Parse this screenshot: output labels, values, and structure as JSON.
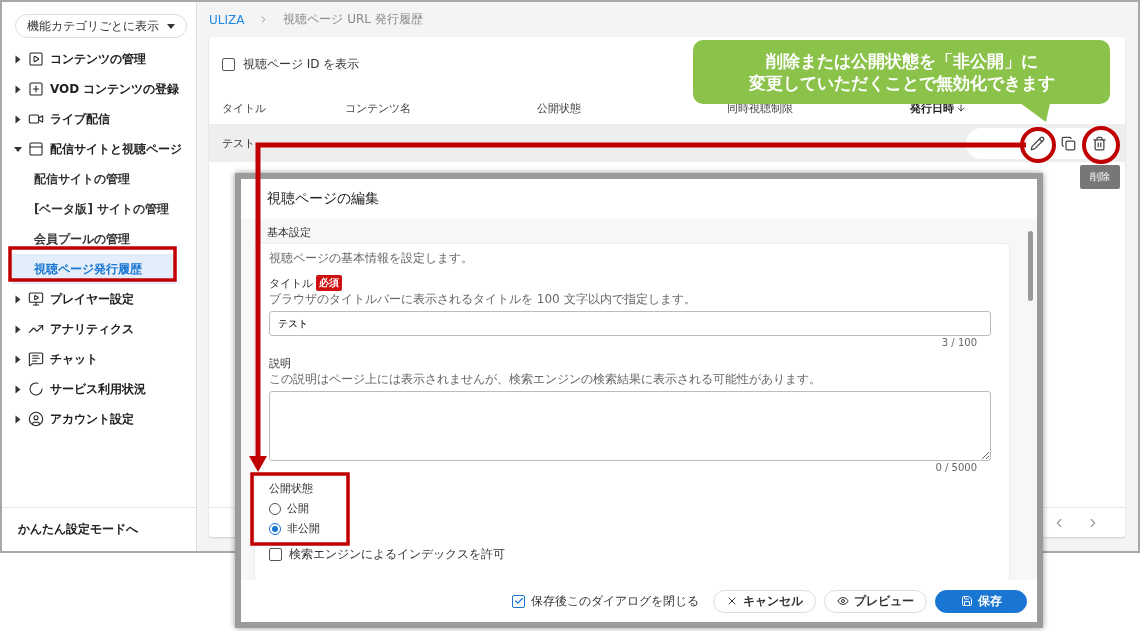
{
  "sidebar": {
    "view_selector": "機能カテゴリごとに表示",
    "items": [
      {
        "label": "コンテンツの管理",
        "expanded": false
      },
      {
        "label": "VOD コンテンツの登録",
        "expanded": false
      },
      {
        "label": "ライブ配信",
        "expanded": false
      },
      {
        "label": "配信サイトと視聴ページ",
        "expanded": true,
        "children": [
          {
            "label": "配信サイトの管理",
            "selected": false
          },
          {
            "label": "[ベータ版] サイトの管理",
            "selected": false
          },
          {
            "label": "会員プールの管理",
            "selected": false
          },
          {
            "label": "視聴ページ発行履歴",
            "selected": true
          }
        ]
      },
      {
        "label": "プレイヤー設定",
        "expanded": false
      },
      {
        "label": "アナリティクス",
        "expanded": false
      },
      {
        "label": "チャット",
        "expanded": false
      },
      {
        "label": "サービス利用状況",
        "expanded": false
      },
      {
        "label": "アカウント設定",
        "expanded": false
      }
    ],
    "footer_link": "かんたん設定モードへ"
  },
  "breadcrumb": [
    "ULIZA",
    "視聴ページ URL 発行履歴"
  ],
  "list": {
    "show_id": {
      "label": "視聴ページ ID を表示",
      "checked": false
    },
    "columns": [
      "タイトル",
      "コンテンツ名",
      "公開状態",
      "同時視聴制限",
      "発行日時"
    ],
    "rows": [
      {
        "title": "テスト"
      }
    ],
    "tooltip": "削除"
  },
  "callout": [
    "削除または公開状態を「非公開」に",
    "変更していただくことで無効化できます"
  ],
  "dialog": {
    "title": "視聴ページの編集",
    "section": "基本設定",
    "intro": "視聴ページの基本情報を設定します。",
    "title_field": {
      "label": "タイトル",
      "badge": "必須",
      "hint": "ブラウザのタイトルバーに表示されるタイトルを 100 文字以内で指定します。",
      "value": "テスト",
      "counter": "3 / 100"
    },
    "description_field": {
      "label": "説明",
      "hint": "この説明はページ上には表示されませんが、検索エンジンの検索結果に表示される可能性があります。",
      "counter": "0 / 5000"
    },
    "visibility": {
      "label": "公開状態",
      "options": [
        {
          "label": "公開",
          "selected": false
        },
        {
          "label": "非公開",
          "selected": true
        }
      ]
    },
    "index_checkbox": {
      "label": "検索エンジンによるインデックスを許可",
      "checked": false
    },
    "close_after_save": {
      "label": "保存後このダイアログを閉じる",
      "checked": true
    },
    "buttons": [
      "キャンセル",
      "プレビュー",
      "保存"
    ]
  }
}
